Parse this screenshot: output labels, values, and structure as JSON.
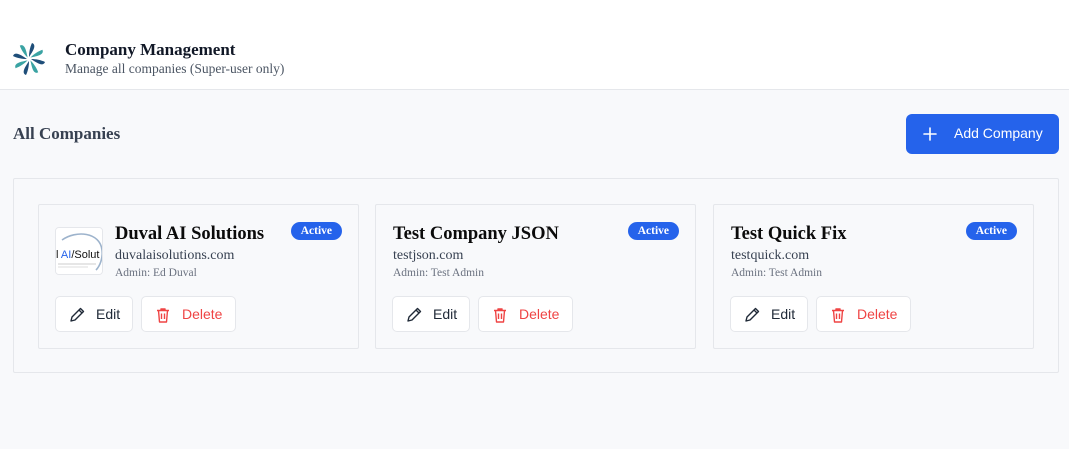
{
  "header": {
    "title": "Company Management",
    "subtitle": "Manage all companies (Super-user only)",
    "logo_icon": "pinwheel-logo-icon"
  },
  "section": {
    "title": "All Companies",
    "add_button_label": "Add Company"
  },
  "companies": [
    {
      "name": "Duval AI Solutions",
      "domain": "duvalaisolutions.com",
      "admin": "Admin: Ed Duval",
      "status": "Active",
      "has_logo": true,
      "logo_text": "l AI Solut"
    },
    {
      "name": "Test Company JSON",
      "domain": "testjson.com",
      "admin": "Admin: Test Admin",
      "status": "Active",
      "has_logo": false
    },
    {
      "name": "Test Quick Fix",
      "domain": "testquick.com",
      "admin": "Admin: Test Admin",
      "status": "Active",
      "has_logo": false
    }
  ],
  "actions": {
    "edit_label": "Edit",
    "delete_label": "Delete"
  },
  "colors": {
    "primary": "#2563eb",
    "danger": "#ef4444",
    "background": "#f8f9fb",
    "border": "#e5e7eb"
  }
}
